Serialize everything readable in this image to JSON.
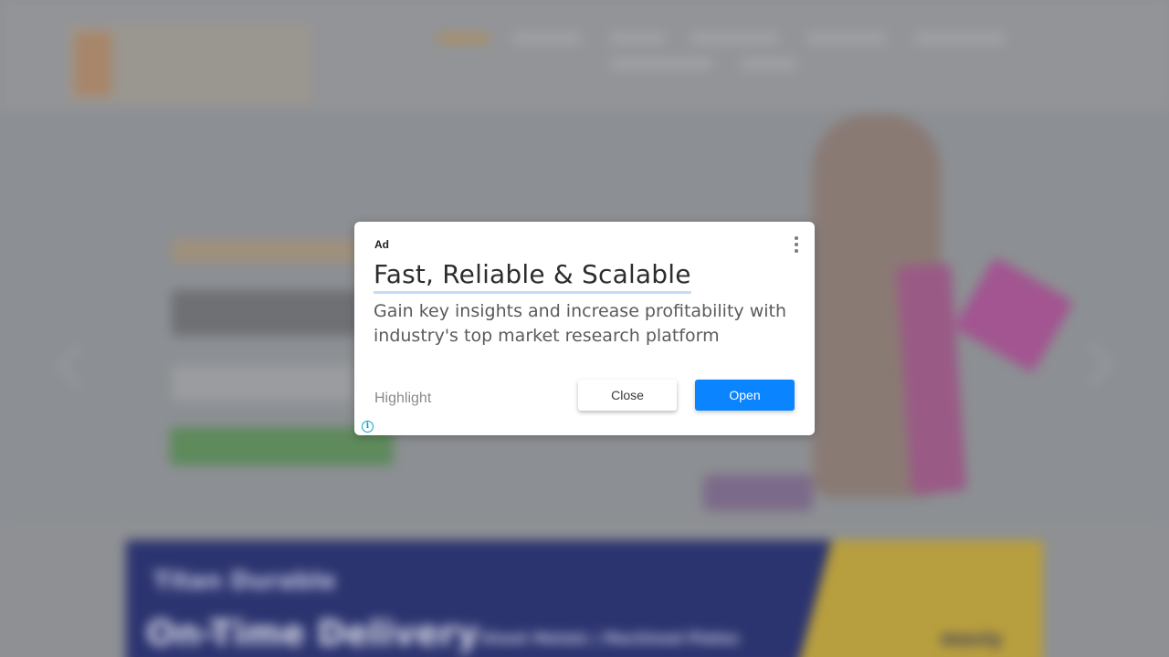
{
  "background": {
    "banner": {
      "headline": "On-Time Delivery",
      "subline": "Sheet Metals | Machined Plates",
      "top_text": "Titan  Durable  ",
      "brand": "moviy"
    }
  },
  "ad": {
    "label": "Ad",
    "menu_icon": "more-vert-icon",
    "headline": "Fast, Reliable & Scalable",
    "body": "Gain key insights and increase profitability with industry's top market research platform",
    "highlight": "Highlight",
    "close_label": "Close",
    "open_label": "Open",
    "info_icon": "info-icon",
    "info_glyph": "i",
    "colors": {
      "open_button": "#0a84ff",
      "info": "#00a6c8",
      "headline_underline": "#c4dcf7"
    }
  }
}
